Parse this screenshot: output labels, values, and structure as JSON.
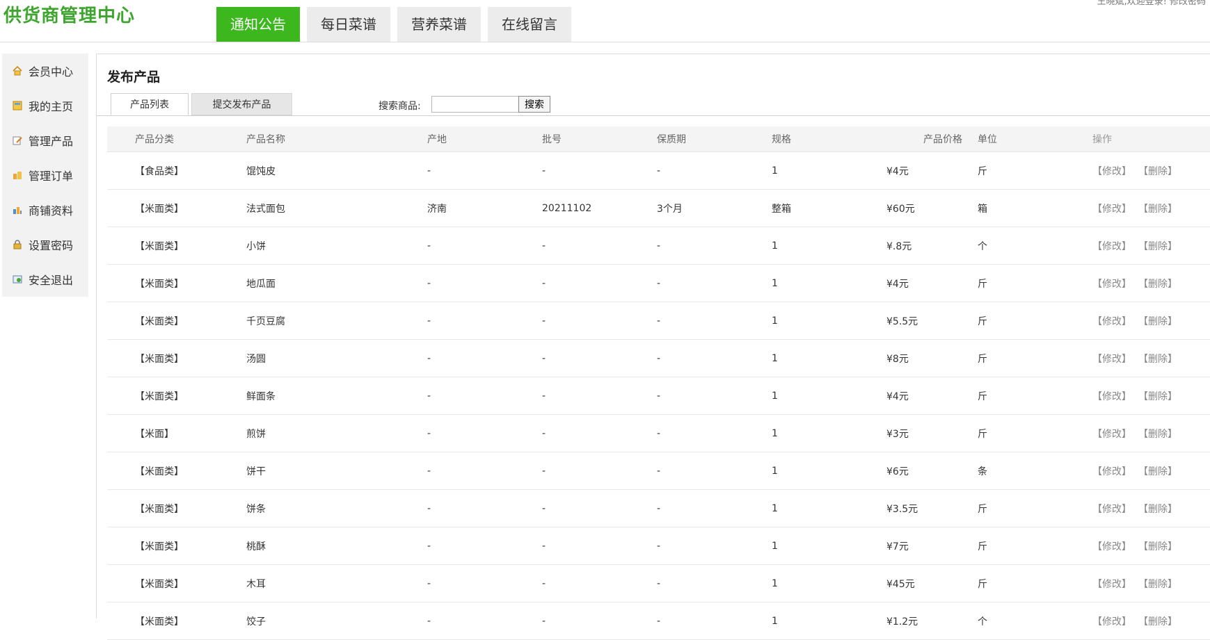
{
  "header": {
    "logo": "供货商管理中心",
    "top_right": "王晓斌,欢迎登录!   修改密码",
    "nav": [
      "通知公告",
      "每日菜谱",
      "营养菜谱",
      "在线留言"
    ]
  },
  "sidebar": {
    "items": [
      {
        "label": "会员中心",
        "icon": "home-icon"
      },
      {
        "label": "我的主页",
        "icon": "page-icon"
      },
      {
        "label": "管理产品",
        "icon": "edit-icon"
      },
      {
        "label": "管理订单",
        "icon": "order-icon"
      },
      {
        "label": "商铺资料",
        "icon": "shop-icon"
      },
      {
        "label": "设置密码",
        "icon": "lock-icon"
      },
      {
        "label": "安全退出",
        "icon": "exit-icon"
      }
    ]
  },
  "content": {
    "title": "发布产品",
    "tabs": [
      "产品列表",
      "提交发布产品"
    ],
    "search": {
      "label": "搜索商品:",
      "value": "",
      "button": "搜索"
    }
  },
  "table": {
    "headers": [
      "产品分类",
      "产品名称",
      "产地",
      "批号",
      "保质期",
      "规格",
      "产品价格",
      "单位",
      "操作"
    ],
    "edit_label": "【修改】",
    "delete_label": "【删除】",
    "rows": [
      {
        "category": "【食品类】",
        "name": "馄饨皮",
        "origin": "-",
        "batch": "-",
        "shelf": "-",
        "spec": "1",
        "price": "¥4元",
        "unit": "斤"
      },
      {
        "category": "【米面类】",
        "name": "法式面包",
        "origin": "济南",
        "batch": "20211102",
        "shelf": "3个月",
        "spec": "整箱",
        "price": "¥60元",
        "unit": "箱"
      },
      {
        "category": "【米面类】",
        "name": "小饼",
        "origin": "-",
        "batch": "-",
        "shelf": "-",
        "spec": "1",
        "price": "¥.8元",
        "unit": "个"
      },
      {
        "category": "【米面类】",
        "name": "地瓜面",
        "origin": "-",
        "batch": "-",
        "shelf": "-",
        "spec": "1",
        "price": "¥4元",
        "unit": "斤"
      },
      {
        "category": "【米面类】",
        "name": "千页豆腐",
        "origin": "-",
        "batch": "-",
        "shelf": "-",
        "spec": "1",
        "price": "¥5.5元",
        "unit": "斤"
      },
      {
        "category": "【米面类】",
        "name": "汤圆",
        "origin": "-",
        "batch": "-",
        "shelf": "-",
        "spec": "1",
        "price": "¥8元",
        "unit": "斤"
      },
      {
        "category": "【米面类】",
        "name": "鲜面条",
        "origin": "-",
        "batch": "-",
        "shelf": "-",
        "spec": "1",
        "price": "¥4元",
        "unit": "斤"
      },
      {
        "category": "【米面】",
        "name": "煎饼",
        "origin": "-",
        "batch": "-",
        "shelf": "-",
        "spec": "1",
        "price": "¥3元",
        "unit": "斤"
      },
      {
        "category": "【米面类】",
        "name": "饼干",
        "origin": "-",
        "batch": "-",
        "shelf": "-",
        "spec": "1",
        "price": "¥6元",
        "unit": "条"
      },
      {
        "category": "【米面类】",
        "name": "饼条",
        "origin": "-",
        "batch": "-",
        "shelf": "-",
        "spec": "1",
        "price": "¥3.5元",
        "unit": "斤"
      },
      {
        "category": "【米面类】",
        "name": "桃酥",
        "origin": "-",
        "batch": "-",
        "shelf": "-",
        "spec": "1",
        "price": "¥7元",
        "unit": "斤"
      },
      {
        "category": "【米面类】",
        "name": "木耳",
        "origin": "-",
        "batch": "-",
        "shelf": "-",
        "spec": "1",
        "price": "¥45元",
        "unit": "斤"
      },
      {
        "category": "【米面类】",
        "name": "饺子",
        "origin": "-",
        "batch": "-",
        "shelf": "-",
        "spec": "1",
        "price": "¥1.2元",
        "unit": "个"
      }
    ]
  }
}
